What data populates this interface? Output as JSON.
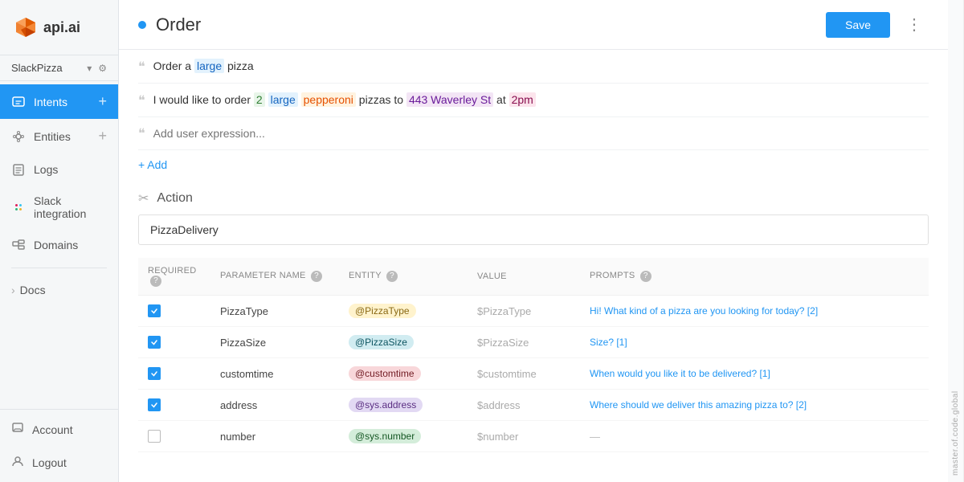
{
  "app": {
    "logo_text": "api.ai",
    "side_label": "master.of.code.global"
  },
  "workspace": {
    "name": "SlackPizza",
    "chevron": "▾",
    "gear": "⚙"
  },
  "sidebar": {
    "items": [
      {
        "id": "intents",
        "label": "Intents",
        "icon": "chat",
        "active": true,
        "has_add": true
      },
      {
        "id": "entities",
        "label": "Entities",
        "icon": "entity",
        "active": false,
        "has_add": true
      },
      {
        "id": "logs",
        "label": "Logs",
        "icon": "logs",
        "active": false,
        "has_add": false
      },
      {
        "id": "slack",
        "label": "Slack integration",
        "icon": "slack",
        "active": false,
        "has_add": false
      },
      {
        "id": "domains",
        "label": "Domains",
        "icon": "domains",
        "active": false,
        "has_add": false
      }
    ],
    "docs_label": "Docs",
    "bottom_items": [
      {
        "id": "account",
        "label": "Account",
        "icon": "account"
      },
      {
        "id": "logout",
        "label": "Logout",
        "icon": "logout"
      }
    ]
  },
  "header": {
    "title": "Order",
    "save_label": "Save",
    "more_icon": "⋮"
  },
  "expressions": [
    {
      "id": "expr1",
      "parts": [
        {
          "text": "Order a ",
          "type": "plain"
        },
        {
          "text": "large",
          "type": "tag-large"
        },
        {
          "text": " pizza",
          "type": "plain"
        }
      ]
    },
    {
      "id": "expr2",
      "parts": [
        {
          "text": "I would like to order ",
          "type": "plain"
        },
        {
          "text": "2",
          "type": "tag-number"
        },
        {
          "text": " ",
          "type": "plain"
        },
        {
          "text": "large",
          "type": "tag-large"
        },
        {
          "text": " ",
          "type": "plain"
        },
        {
          "text": "pepperoni",
          "type": "tag-pepperoni"
        },
        {
          "text": " pizzas to ",
          "type": "plain"
        },
        {
          "text": "443 Waverley St",
          "type": "tag-address"
        },
        {
          "text": " at ",
          "type": "plain"
        },
        {
          "text": "2pm",
          "type": "tag-time"
        }
      ]
    }
  ],
  "add_expression_label": "+ Add",
  "expression_placeholder": "Add user expression...",
  "action": {
    "section_label": "Action",
    "value": "PizzaDelivery"
  },
  "table": {
    "headers": [
      {
        "key": "required",
        "label": "REQUIRED"
      },
      {
        "key": "param_name",
        "label": "PARAMETER NAME"
      },
      {
        "key": "entity",
        "label": "ENTITY"
      },
      {
        "key": "value",
        "label": "VALUE"
      },
      {
        "key": "prompts",
        "label": "PROMPTS"
      }
    ],
    "rows": [
      {
        "required": true,
        "param_name": "PizzaType",
        "entity": "@PizzaType",
        "entity_class": "entity-pizza-type",
        "value": "$PizzaType",
        "prompts": "Hi! What kind of a pizza are you looking for today? [2]",
        "prompts_class": "prompts-text"
      },
      {
        "required": true,
        "param_name": "PizzaSize",
        "entity": "@PizzaSize",
        "entity_class": "entity-pizza-size",
        "value": "$PizzaSize",
        "prompts": "Size? [1]",
        "prompts_class": "prompts-text"
      },
      {
        "required": true,
        "param_name": "customtime",
        "entity": "@customtime",
        "entity_class": "entity-customtime",
        "value": "$customtime",
        "prompts": "When would you like it to be delivered? [1]",
        "prompts_class": "prompts-text"
      },
      {
        "required": true,
        "param_name": "address",
        "entity": "@sys.address",
        "entity_class": "entity-address",
        "value": "$address",
        "prompts": "Where should we deliver this amazing pizza to? [2]",
        "prompts_class": "prompts-text"
      },
      {
        "required": false,
        "param_name": "number",
        "entity": "@sys.number",
        "entity_class": "entity-number",
        "value": "$number",
        "prompts": "—",
        "prompts_class": "dash-cell"
      }
    ]
  }
}
